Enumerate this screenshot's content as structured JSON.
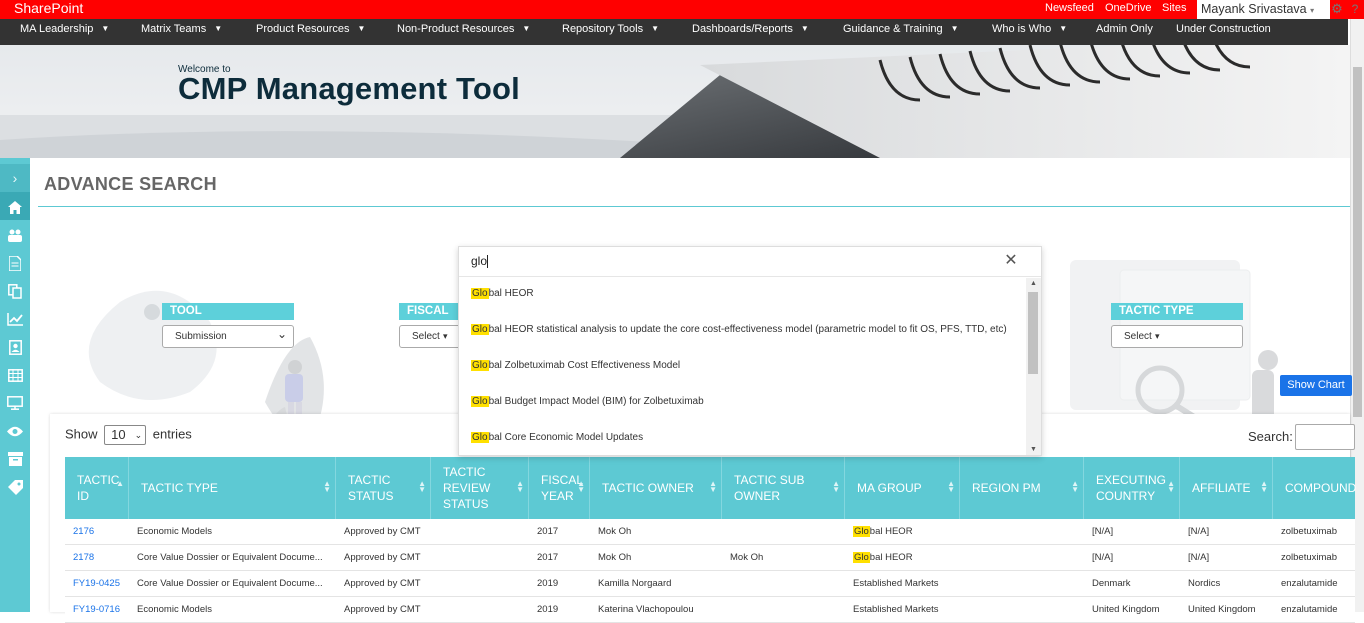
{
  "suitebar": {
    "brand": "SharePoint",
    "links": [
      "Newsfeed",
      "OneDrive",
      "Sites"
    ],
    "user": "Mayank Srivastava",
    "user_caret": "▾",
    "gear": "⚙",
    "help": "?"
  },
  "nav": {
    "items": [
      "MA Leadership",
      "Matrix Teams",
      "Product Resources",
      "Non-Product Resources",
      "Repository Tools",
      "Dashboards/Reports",
      "Guidance & Training",
      "Who is Who",
      "Admin Only",
      "Under Construction"
    ],
    "dropdown_glyph": "▼"
  },
  "banner": {
    "welcome": "Welcome to",
    "title": "CMP Management Tool"
  },
  "page": {
    "title": "ADVANCE SEARCH"
  },
  "sidebar": {
    "toggle": "›",
    "icons": [
      "home-icon",
      "users-icon",
      "document-icon",
      "copy-icon",
      "chart-icon",
      "contact-icon",
      "table-icon",
      "monitor-icon",
      "eye-icon",
      "archive-icon",
      "tag-icon"
    ]
  },
  "filters": {
    "tool": {
      "label": "TOOL",
      "value": "Submission",
      "caret": "⌄"
    },
    "fiscal_year": {
      "label": "FISCAL YEAR",
      "value": "Select",
      "caret": "▾"
    },
    "tactic_type": {
      "label": "TACTIC TYPE",
      "value": "Select",
      "caret": "▾"
    }
  },
  "show_chart": "Show Chart",
  "table_controls": {
    "show": "Show",
    "entries_value": "10",
    "entries_caret": "⌄",
    "entries": "entries",
    "search_label": "Search:"
  },
  "table": {
    "headers": [
      "TACTIC ID",
      "TACTIC TYPE",
      "TACTIC STATUS",
      "TACTIC REVIEW STATUS",
      "FISCAL YEAR",
      "TACTIC OWNER",
      "TACTIC SUB OWNER",
      "MA GROUP",
      "REGION PM",
      "EXECUTING COUNTRY",
      "AFFILIATE",
      "COMPOUND"
    ],
    "rows": [
      [
        "2176",
        "Economic Models",
        "Approved by CMT",
        "",
        "2017",
        "Mok Oh",
        "",
        "Global HEOR",
        "",
        "[N/A]",
        "[N/A]",
        "zolbetuximab"
      ],
      [
        "2178",
        "Core Value Dossier or Equivalent Docume...",
        "Approved by CMT",
        "",
        "2017",
        "Mok Oh",
        "Mok Oh",
        "Global HEOR",
        "",
        "[N/A]",
        "[N/A]",
        "zolbetuximab"
      ],
      [
        "FY19-0425",
        "Core Value Dossier or Equivalent Docume...",
        "Approved by CMT",
        "",
        "2019",
        "Kamilla Norgaard",
        "",
        "Established Markets",
        "",
        "Denmark",
        "Nordics",
        "enzalutamide"
      ],
      [
        "FY19-0716",
        "Economic Models",
        "Approved by CMT",
        "",
        "2019",
        "Katerina Vlachopoulou",
        "",
        "Established Markets",
        "",
        "United Kingdom",
        "United Kingdom",
        "enzalutamide"
      ]
    ]
  },
  "search_dropdown": {
    "query": "glo",
    "close": "✕",
    "match": "Glo",
    "options": [
      "bal HEOR",
      "bal HEOR statistical analysis to update the core cost-effectiveness model (parametric model to fit OS, PFS, TTD, etc)",
      "bal Zolbetuximab Cost Effectiveness Model",
      "bal Budget Impact Model (BIM) for Zolbetuximab",
      "bal Core Economic Model Updates"
    ]
  },
  "colors": {
    "suitebar": "#ff0000",
    "nav": "#333333",
    "accent": "#5dc9d3",
    "highlight": "#ffe000",
    "button": "#1a73e8"
  }
}
